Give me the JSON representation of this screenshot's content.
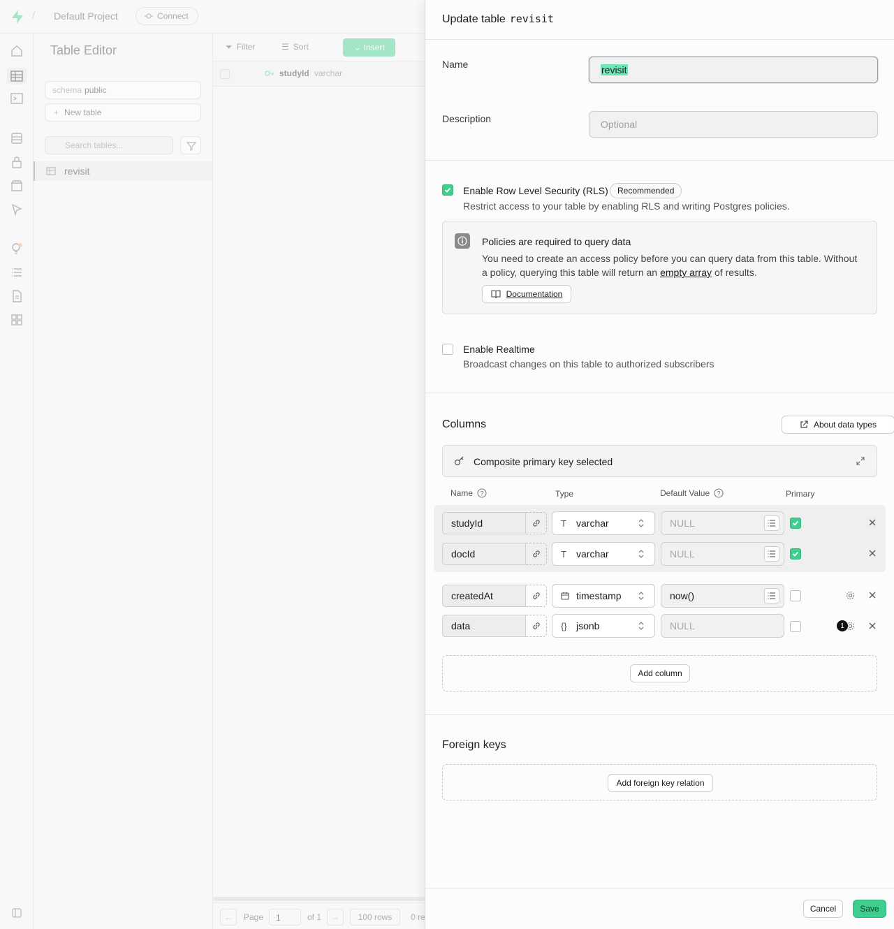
{
  "topbar": {
    "project_name": "Default Project",
    "connect_label": "Connect"
  },
  "sidebar": {
    "title": "Table Editor",
    "schema_prefix": "schema",
    "schema_value": "public",
    "new_table_label": "New table",
    "search_placeholder": "Search tables...",
    "tables": [
      {
        "name": "revisit"
      }
    ]
  },
  "grid": {
    "filter_label": "Filter",
    "sort_label": "Sort",
    "insert_label": "Insert",
    "column_name": "studyId",
    "column_type": "varchar",
    "footer": {
      "page_label": "Page",
      "page_value": "1",
      "of_label": "of 1",
      "rows_label": "100 rows",
      "records_label": "0 re"
    }
  },
  "panel": {
    "title_prefix": "Update table",
    "title_table": "revisit",
    "name_label": "Name",
    "name_value": "revisit",
    "description_label": "Description",
    "description_placeholder": "Optional",
    "rls": {
      "label": "Enable Row Level Security (RLS)",
      "badge": "Recommended",
      "description": "Restrict access to your table by enabling RLS and writing Postgres policies.",
      "checked": true
    },
    "policy_notice": {
      "title": "Policies are required to query data",
      "body_line1": "You need to create an access policy before you can query data from this table. Without",
      "body_line2_prefix": "a policy, querying this table will return an",
      "body_link": "empty array",
      "body_line2_suffix": "of results.",
      "doc_button": "Documentation"
    },
    "realtime": {
      "label": "Enable Realtime",
      "description": "Broadcast changes on this table to authorized subscribers",
      "checked": false
    },
    "columns_section": {
      "title": "Columns",
      "about_button": "About data types",
      "composite_key_label": "Composite primary key selected",
      "headers": {
        "name": "Name",
        "type": "Type",
        "default_value": "Default Value",
        "primary": "Primary"
      },
      "rows": [
        {
          "name": "studyId",
          "type_icon": "T",
          "type": "varchar",
          "default": "NULL",
          "default_is_placeholder": true,
          "primary": true
        },
        {
          "name": "docId",
          "type_icon": "T",
          "type": "varchar",
          "default": "NULL",
          "default_is_placeholder": true,
          "primary": true
        },
        {
          "name": "createdAt",
          "type_icon": "calendar-icon",
          "type": "timestamp",
          "default": "now()",
          "default_is_placeholder": false,
          "primary": false
        },
        {
          "name": "data",
          "type_icon": "{}",
          "type": "jsonb",
          "default": "NULL",
          "default_is_placeholder": true,
          "primary": false,
          "badge_count": "1"
        }
      ],
      "add_column_label": "Add column"
    },
    "foreign_keys": {
      "title": "Foreign keys",
      "add_label": "Add foreign key relation"
    },
    "footer": {
      "cancel_label": "Cancel",
      "save_label": "Save"
    }
  },
  "colors": {
    "brand_green": "#3ecf8e",
    "brand_green_dark": "#34b27b",
    "selection_highlight": "#6ee7b7",
    "text_primary": "#1c1c1c",
    "text_muted": "#707070"
  }
}
